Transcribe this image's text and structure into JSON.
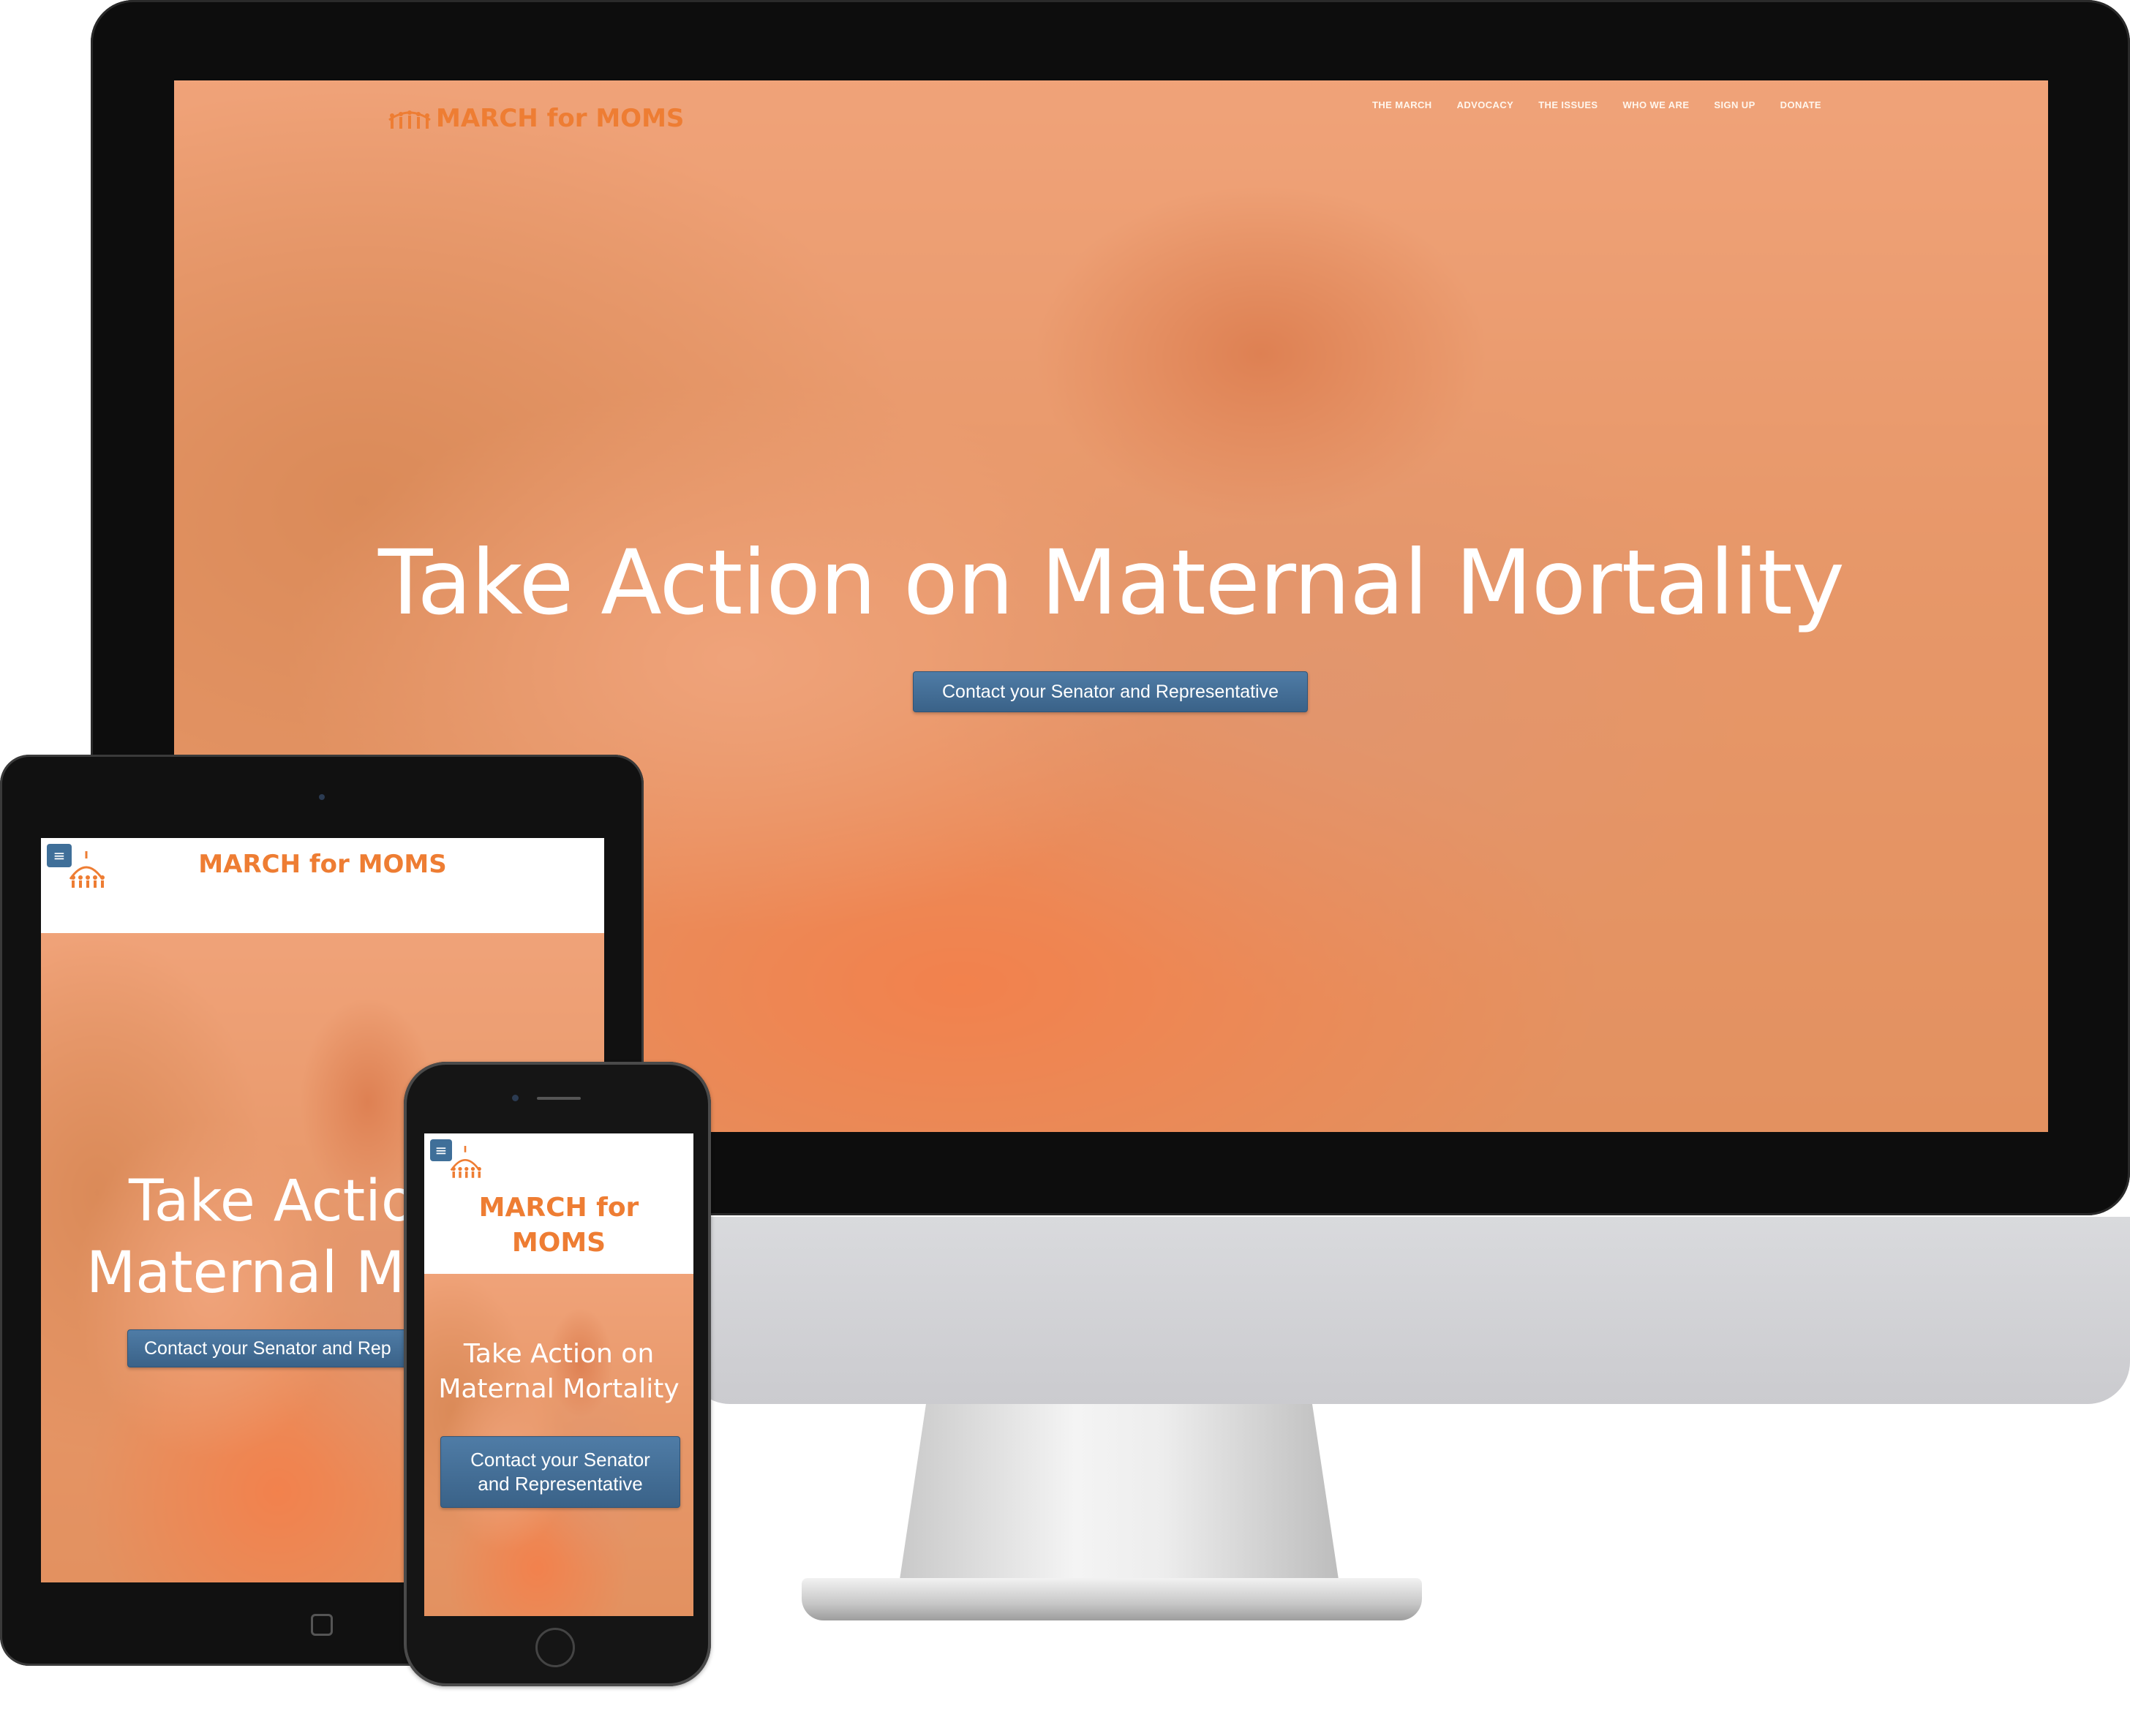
{
  "site": {
    "name": "MARCH for MOMS",
    "name_mobile_line1": "MARCH for",
    "name_mobile_line2": "MOMS"
  },
  "nav": [
    {
      "label": "THE MARCH"
    },
    {
      "label": "ADVOCACY"
    },
    {
      "label": "THE ISSUES"
    },
    {
      "label": "WHO WE ARE"
    },
    {
      "label": "SIGN UP"
    },
    {
      "label": "DONATE"
    }
  ],
  "hero": {
    "headline": "Take Action  on Maternal Mortality",
    "headline_tablet_line1": "Take Action",
    "headline_tablet_line2": "Maternal Mo",
    "headline_phone_line1": "Take Action  on",
    "headline_phone_line2": "Maternal Mortality",
    "cta": "Contact your Senator and Representative",
    "cta_tablet": "Contact your Senator and Rep",
    "cta_phone_line1": "Contact your Senator",
    "cta_phone_line2": "and Representative"
  },
  "icons": {
    "menu": "hamburger-menu-icon",
    "logo": "capitol-dome-people-icon"
  },
  "colors": {
    "brand_orange": "#ee7d33",
    "hero_tint": "#f28a54",
    "button_blue": "#3f6f99"
  }
}
